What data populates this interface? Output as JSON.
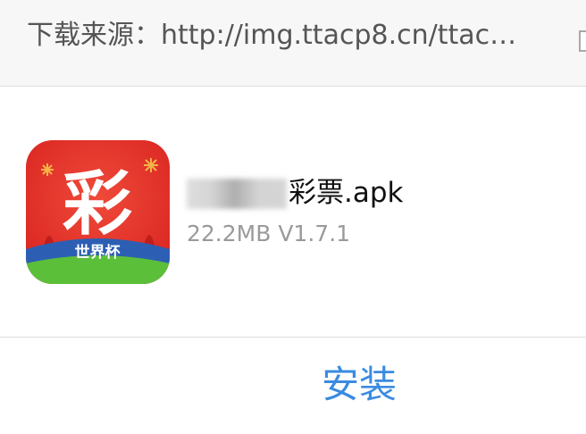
{
  "download_dialog": {
    "source_label": "下载来源：http://img.ttacp8.cn/ttac…",
    "app": {
      "name_visible": "彩票.apk",
      "size_version": "22.2MB V1.7.1",
      "icon_main_char": "彩",
      "icon_caption": "世界杯",
      "icon_colors": {
        "background": "#e8322b",
        "main_text": "#ffffff",
        "band": "#2c5fb3",
        "caption": "#ffffff",
        "grass": "#5bbf3a"
      }
    },
    "install_label": "安装",
    "accent_color": "#3b8be0"
  }
}
